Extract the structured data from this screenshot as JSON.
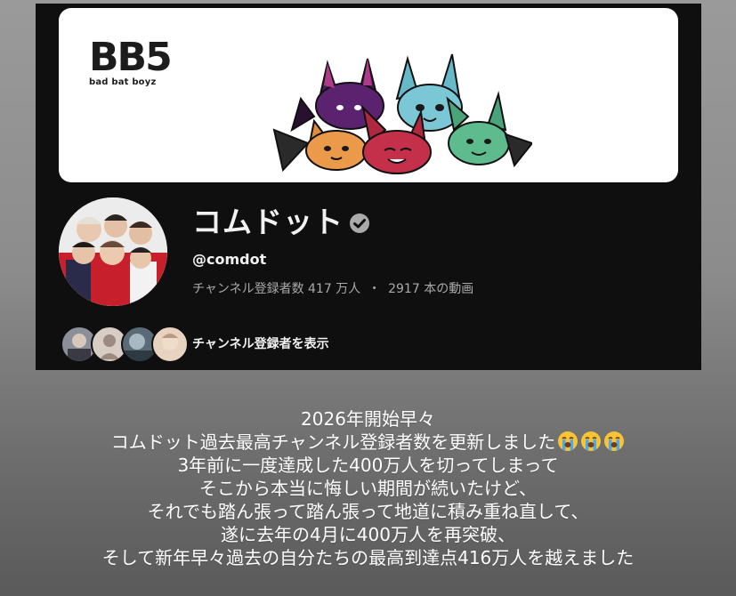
{
  "banner": {
    "logo_main": "BB5",
    "logo_sub": "bad bat boyz"
  },
  "channel": {
    "name": "コムドット",
    "handle": "@comdot",
    "subscribers": "チャンネル登録者数 417 万人",
    "separator": "・",
    "videos": "2917 本の動画",
    "subscribers_link": "チャンネル登録者を表示",
    "verified_icon": "verified-check-icon"
  },
  "caption": {
    "lines": [
      "2026年開始早々",
      "コムドット過去最高チャンネル登録者数を更新しました",
      "3年前に一度達成した400万人を切ってしまって",
      "そこから本当に悔しい期間が続いたけど、",
      "それでも踏ん張って踏ん張って地道に積み重ね直して、",
      "遂に去年の4月に400万人を再突破、",
      "そして新年早々過去の自分たちの最高到達点416万人を越えました"
    ],
    "emoji": "loudly-crying-face-icon"
  },
  "colors": {
    "app_background": "#0f0f0f",
    "text_primary": "#f1f1f1",
    "text_secondary": "#aaaaaa"
  }
}
